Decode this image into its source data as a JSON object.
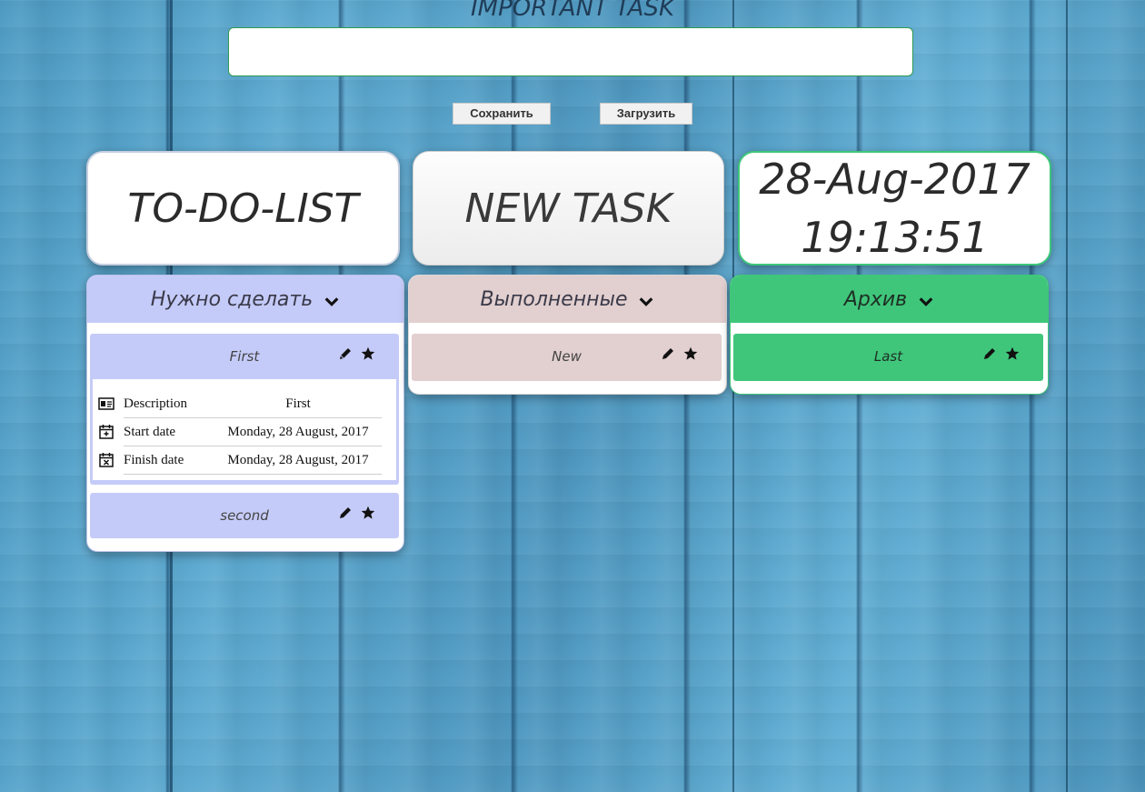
{
  "header": {
    "title": "IMPORTANT TASK",
    "input_value": "",
    "save_label": "Сохранить",
    "load_label": "Загрузить"
  },
  "tiles": {
    "todo_list": "TO-DO-LIST",
    "new_task": "NEW TASK",
    "date": "28-Aug-2017",
    "time": "19:13:51"
  },
  "columns": {
    "todo": {
      "title": "Нужно сделать",
      "tasks": [
        {
          "name": "First",
          "details": {
            "description_label": "Description",
            "description_value": "First",
            "start_label": "Start date",
            "start_value": "Monday, 28 August, 2017",
            "finish_label": "Finish date",
            "finish_value": "Monday, 28 August, 2017"
          }
        },
        {
          "name": "second"
        }
      ]
    },
    "done": {
      "title": "Выполненные",
      "tasks": [
        {
          "name": "New"
        }
      ]
    },
    "archive": {
      "title": "Архив",
      "tasks": [
        {
          "name": "Last"
        }
      ]
    }
  },
  "colors": {
    "todo": "#c5cbf8",
    "done": "#e2cfcf",
    "archive": "#3fc67a",
    "input_border": "#2f9a4f"
  }
}
